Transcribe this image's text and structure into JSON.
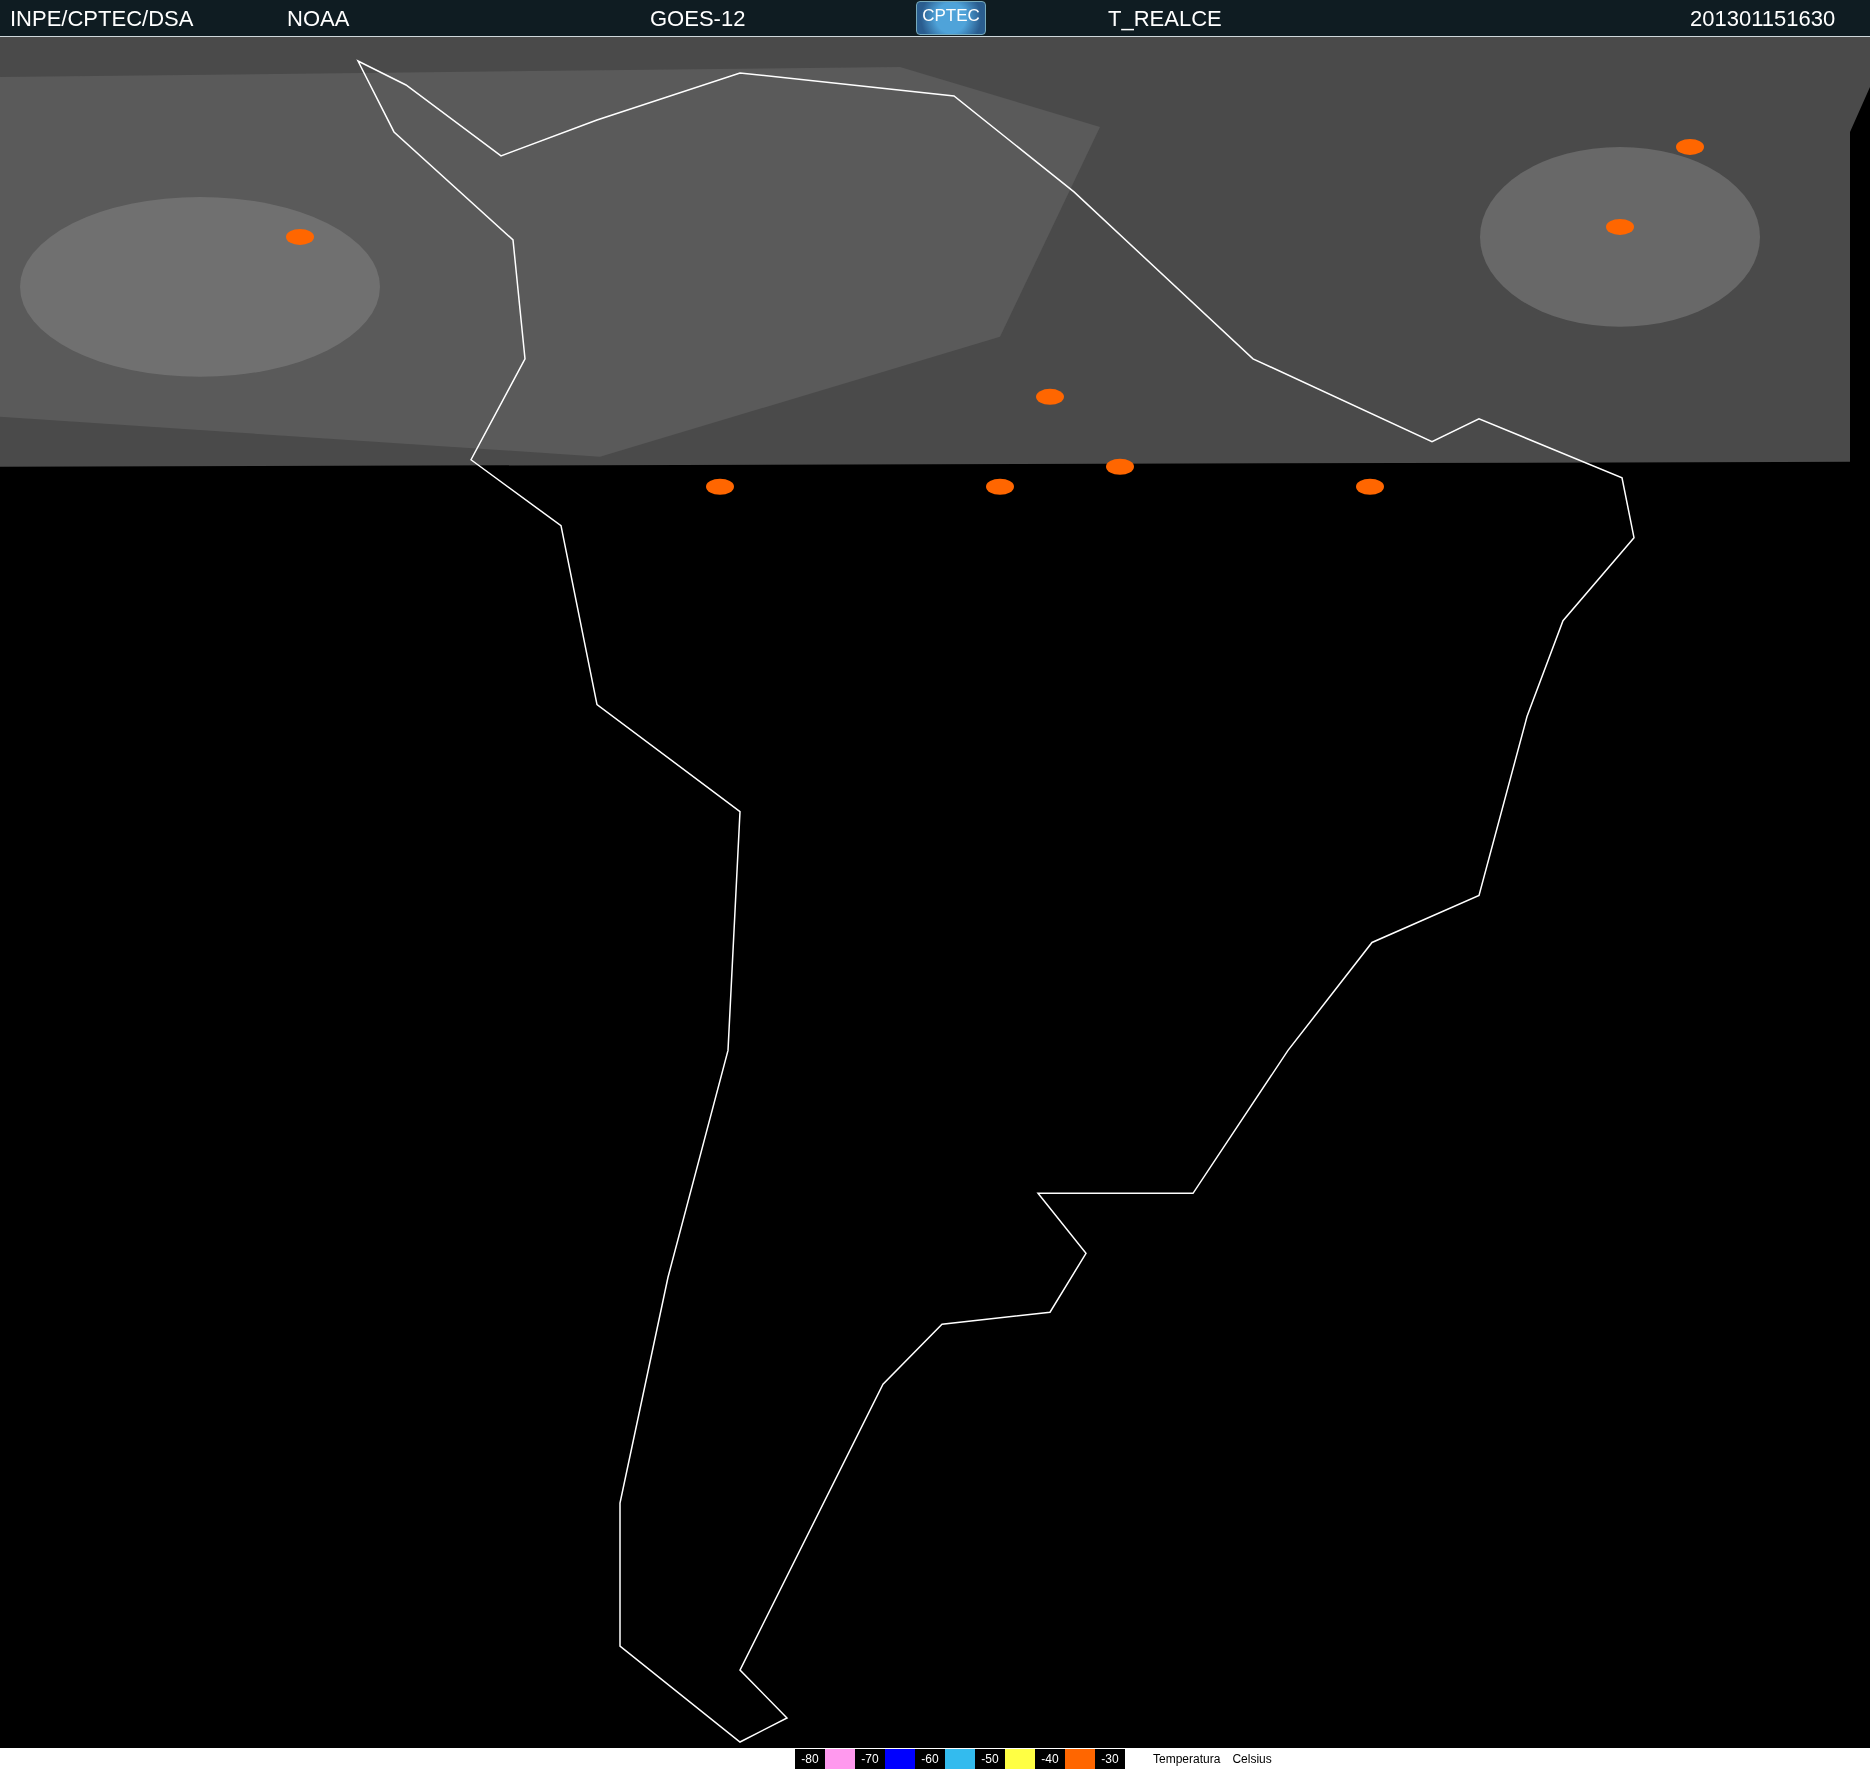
{
  "header": {
    "items": [
      {
        "kind": "text",
        "text": "INPE/CPTEC/DSA"
      },
      {
        "kind": "text",
        "text": "NOAA"
      },
      {
        "kind": "text",
        "text": "GOES-12"
      },
      {
        "kind": "logo",
        "text": "CPTEC"
      },
      {
        "kind": "text",
        "text": "T_REALCE"
      },
      {
        "kind": "text",
        "text": "201301151630"
      }
    ]
  },
  "legend": {
    "entries": [
      {
        "kind": "label",
        "text": "-80"
      },
      {
        "kind": "swatch",
        "color": "#ff99ee"
      },
      {
        "kind": "label",
        "text": "-70"
      },
      {
        "kind": "swatch",
        "color": "#0000ff"
      },
      {
        "kind": "label",
        "text": "-60"
      },
      {
        "kind": "swatch",
        "color": "#33bbee"
      },
      {
        "kind": "label",
        "text": "-50"
      },
      {
        "kind": "swatch",
        "color": "#ffff44"
      },
      {
        "kind": "label",
        "text": "-40"
      },
      {
        "kind": "swatch",
        "color": "#ff6600"
      },
      {
        "kind": "label",
        "text": "-30"
      }
    ],
    "caption": [
      "Temperatura",
      "Celsius"
    ]
  }
}
